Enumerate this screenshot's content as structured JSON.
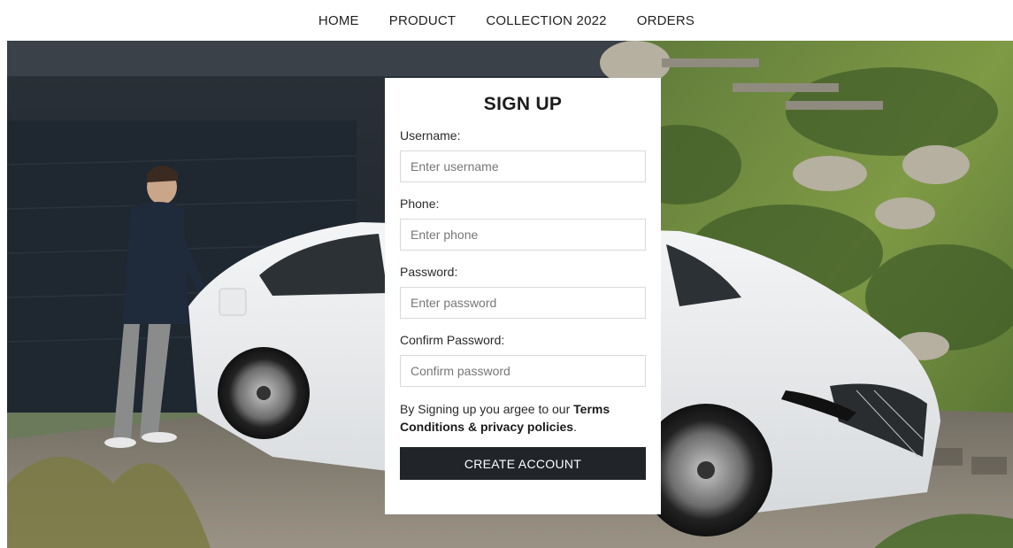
{
  "nav": {
    "items": [
      {
        "label": "HOME"
      },
      {
        "label": "PRODUCT"
      },
      {
        "label": "COLLECTION 2022"
      },
      {
        "label": "ORDERS"
      }
    ]
  },
  "form": {
    "title": "SIGN UP",
    "username": {
      "label": "Username:",
      "placeholder": "Enter username",
      "value": ""
    },
    "phone": {
      "label": "Phone:",
      "placeholder": "Enter phone",
      "value": ""
    },
    "password": {
      "label": "Password:",
      "placeholder": "Enter password",
      "value": ""
    },
    "confirm": {
      "label": "Confirm Password:",
      "placeholder": "Confirm password",
      "value": ""
    },
    "terms_prefix": "By Signing up you argee to our ",
    "terms_link": "Terms Conditions & privacy policies",
    "terms_suffix": ".",
    "submit_label": "CREATE ACCOUNT"
  },
  "colors": {
    "button_bg": "#212529",
    "card_bg": "#ffffff",
    "input_border": "#d9d9d9"
  }
}
